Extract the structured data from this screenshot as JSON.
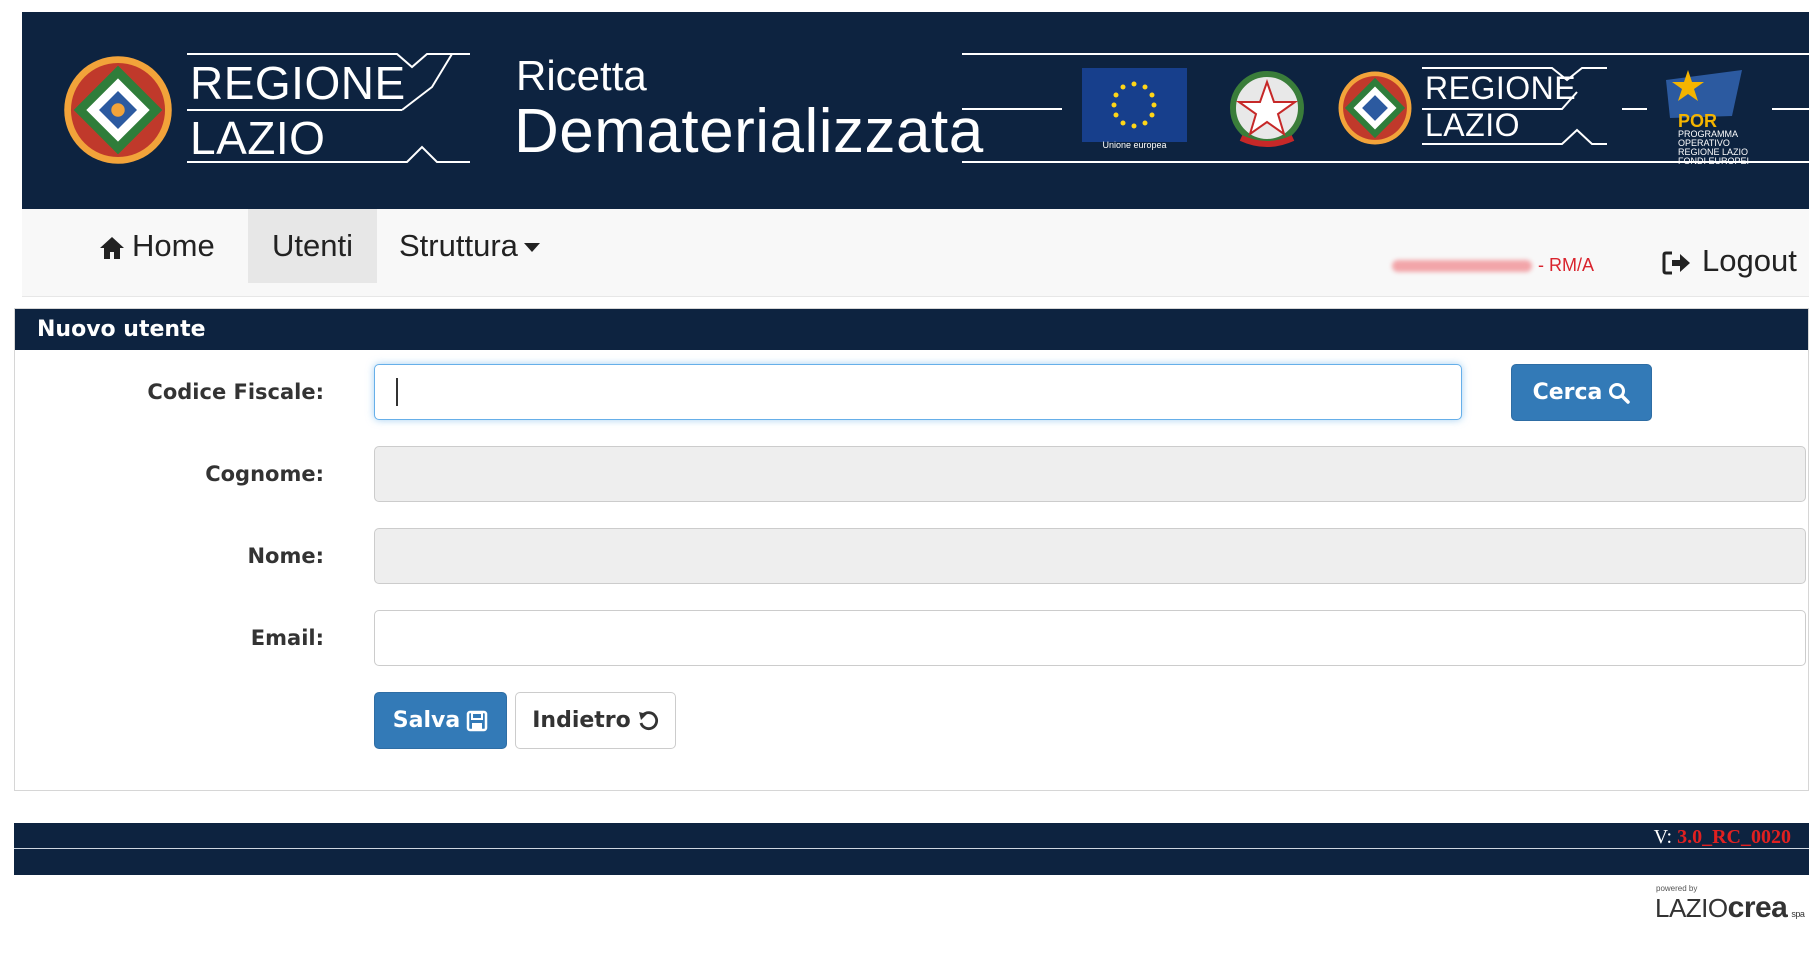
{
  "header": {
    "logo_line1": "REGIONE",
    "logo_line2": "LAZIO",
    "app_title_small": "Ricetta",
    "app_title_big": "Dematerializzata",
    "eu_caption": "Unione europea",
    "logo2_line1": "REGIONE",
    "logo2_line2": "LAZIO",
    "por_title": "POR",
    "por_caption": "PROGRAMMA OPERATIVO REGIONE LAZIO FONDI EUROPEI"
  },
  "nav": {
    "home": "Home",
    "utenti": "Utenti",
    "struttura": "Struttura",
    "user_suffix": "- RM/A",
    "logout": "Logout"
  },
  "panel": {
    "title": "Nuovo utente",
    "fields": {
      "codice_fiscale": {
        "label": "Codice Fiscale:",
        "value": ""
      },
      "cognome": {
        "label": "Cognome:",
        "value": ""
      },
      "nome": {
        "label": "Nome:",
        "value": ""
      },
      "email": {
        "label": "Email:",
        "value": ""
      }
    },
    "buttons": {
      "cerca": "Cerca",
      "salva": "Salva",
      "indietro": "Indietro"
    }
  },
  "footer": {
    "version_prefix": "V:",
    "version": "3.0_RC_0020",
    "powered_by": "powered by",
    "brand_lazio": "LAZIO",
    "brand_crea": "crea",
    "brand_spa": "spa"
  },
  "colors": {
    "navy": "#0d2340",
    "primary_button": "#337ab7",
    "version_red": "#e02020",
    "active_nav": "#e7e7e7"
  }
}
